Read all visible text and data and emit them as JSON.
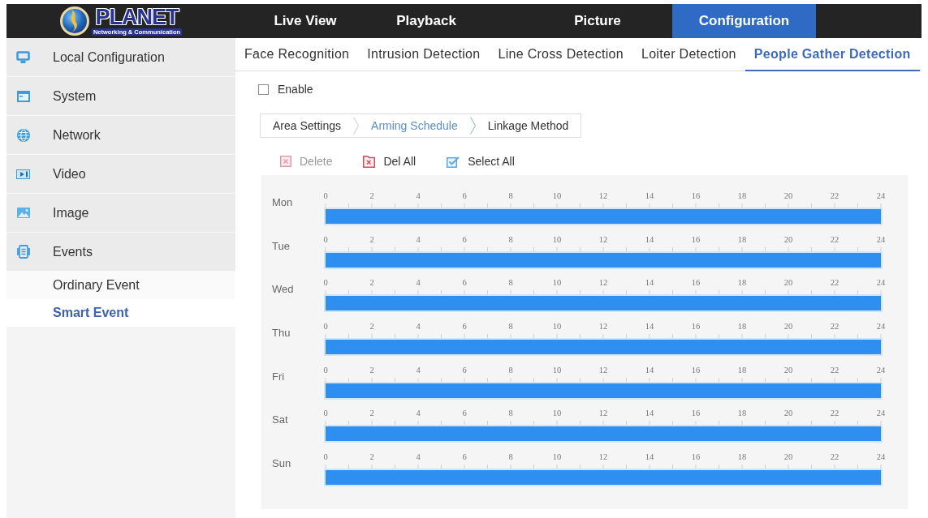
{
  "top_nav": {
    "logo": {
      "name": "PLANET",
      "tagline": "Networking & Communication"
    },
    "items": [
      {
        "label": "Live View",
        "selected": false
      },
      {
        "label": "Playback",
        "selected": false
      },
      {
        "label": "Picture",
        "selected": false
      },
      {
        "label": "Configuration",
        "selected": true
      }
    ]
  },
  "sidebar": {
    "items": [
      {
        "label": "Local Configuration",
        "selected": false
      },
      {
        "label": "System",
        "selected": false
      },
      {
        "label": "Network",
        "selected": false
      },
      {
        "label": "Video",
        "selected": false
      },
      {
        "label": "Image",
        "selected": false
      },
      {
        "label": "Events",
        "selected": false,
        "expanded": true,
        "children": [
          {
            "label": "Ordinary Event",
            "selected": false
          },
          {
            "label": "Smart Event",
            "selected": true
          }
        ]
      }
    ]
  },
  "detection_tabs": [
    {
      "label": "Face Recognition",
      "selected": false
    },
    {
      "label": "Intrusion Detection",
      "selected": false
    },
    {
      "label": "Line Cross Detection",
      "selected": false
    },
    {
      "label": "Loiter Detection",
      "selected": false
    },
    {
      "label": "People Gather Detection",
      "selected": true
    }
  ],
  "enable": {
    "label": "Enable",
    "checked": false
  },
  "step_tabs": [
    {
      "label": "Area Settings",
      "selected": false
    },
    {
      "label": "Arming Schedule",
      "selected": true
    },
    {
      "label": "Linkage Method",
      "selected": false
    }
  ],
  "toolbar": [
    {
      "kind": "delete",
      "label": "Delete",
      "disabled": true
    },
    {
      "kind": "clear",
      "label": "Del All",
      "disabled": false
    },
    {
      "kind": "select",
      "label": "Select All",
      "disabled": false
    }
  ],
  "schedule": {
    "days": [
      {
        "label": "Mon",
        "ticks": [
          "0",
          "2",
          "4",
          "6",
          "8",
          "10",
          "12",
          "14",
          "16",
          "18",
          "20",
          "22",
          "24"
        ],
        "level": 1
      },
      {
        "label": "Tue",
        "ticks": [
          "0",
          "2",
          "4",
          "6",
          "8",
          "10",
          "12",
          "14",
          "16",
          "18",
          "20",
          "22",
          "24"
        ],
        "level": 1
      },
      {
        "label": "Wed",
        "ticks": [
          "0",
          "2",
          "4",
          "6",
          "8",
          "10",
          "12",
          "14",
          "16",
          "18",
          "20",
          "22",
          "24"
        ],
        "level": 1
      },
      {
        "label": "Thu",
        "ticks": [
          "0",
          "2",
          "4",
          "6",
          "8",
          "10",
          "12",
          "14",
          "16",
          "18",
          "20",
          "22",
          "24"
        ],
        "level": 1
      },
      {
        "label": "Fri",
        "ticks": [
          "0",
          "2",
          "4",
          "6",
          "8",
          "10",
          "12",
          "14",
          "16",
          "18",
          "20",
          "22",
          "24"
        ],
        "level": 1
      },
      {
        "label": "Sat",
        "ticks": [
          "0",
          "2",
          "4",
          "6",
          "8",
          "10",
          "12",
          "14",
          "16",
          "18",
          "20",
          "22",
          "24"
        ],
        "level": 1
      },
      {
        "label": "Sun",
        "ticks": [
          "0",
          "2",
          "4",
          "6",
          "8",
          "10",
          "12",
          "14",
          "16",
          "18",
          "20",
          "22",
          "24"
        ],
        "level": 1
      }
    ]
  }
}
